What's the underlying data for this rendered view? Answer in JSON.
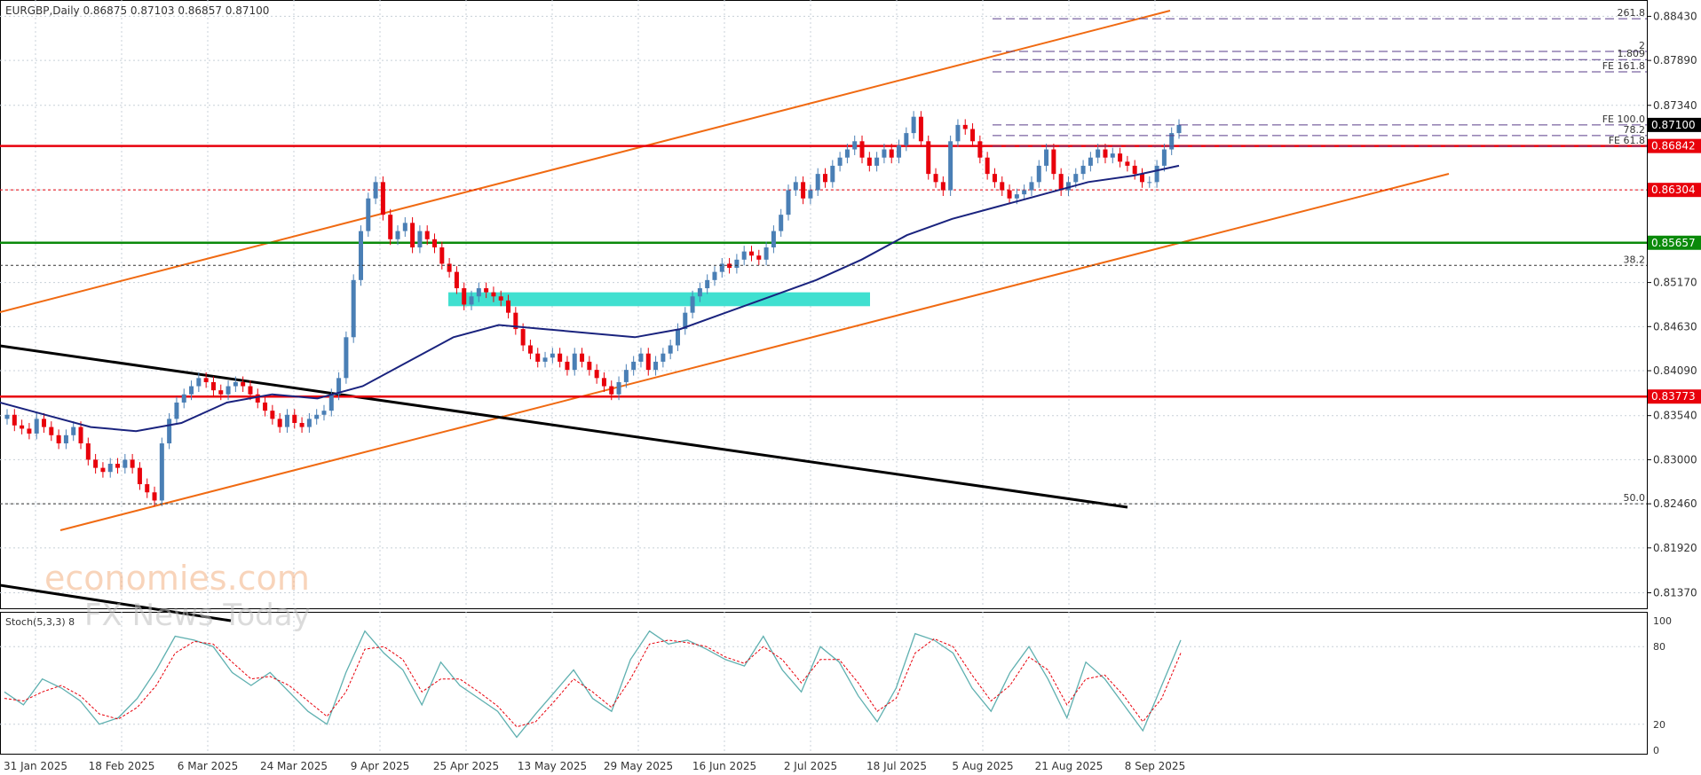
{
  "header": {
    "symbol_line": "EURGBP,Daily  0.86875 0.87103 0.86857 0.87100"
  },
  "stoch_label": "Stoch(5,3,3) 8",
  "watermark": {
    "line1": "economies.com",
    "line2": "FX News Today"
  },
  "colors": {
    "bull": "#4a7fb5",
    "bear": "#e8000b",
    "ma": "#1a237e",
    "channel": "#f06a12",
    "support_green": "#0a8a0a",
    "resistance_red": "#e8000b",
    "zone": "#40e0d0",
    "trend_black": "#000000",
    "fib_purple": "#5a3d8a",
    "stoch_main": "#5fb0b0",
    "stoch_signal": "#e8000b"
  },
  "chart_data": {
    "type": "candlestick",
    "symbol": "EURGBP",
    "timeframe": "Daily",
    "ohlc_last": {
      "open": 0.86875,
      "high": 0.87103,
      "low": 0.86857,
      "close": 0.871
    },
    "y_ticks": [
      "0.88430",
      "0.87890",
      "0.87340",
      "0.86842",
      "0.86304",
      "0.85657",
      "0.85170",
      "0.84630",
      "0.84090",
      "0.83773",
      "0.83540",
      "0.83000",
      "0.82460",
      "0.81920",
      "0.81370"
    ],
    "ylim": [
      0.8118,
      0.8863
    ],
    "x_ticks": [
      "31 Jan 2025",
      "18 Feb 2025",
      "6 Mar 2025",
      "24 Mar 2025",
      "9 Apr 2025",
      "25 Apr 2025",
      "13 May 2025",
      "29 May 2025",
      "16 Jun 2025",
      "2 Jul 2025",
      "18 Jul 2025",
      "5 Aug 2025",
      "21 Aug 2025",
      "8 Sep 2025"
    ],
    "closes": [
      0.8355,
      0.8342,
      0.8338,
      0.8332,
      0.835,
      0.834,
      0.833,
      0.832,
      0.833,
      0.834,
      0.832,
      0.83,
      0.829,
      0.8285,
      0.8295,
      0.829,
      0.83,
      0.829,
      0.827,
      0.826,
      0.825,
      0.832,
      0.835,
      0.837,
      0.838,
      0.839,
      0.84,
      0.8395,
      0.8385,
      0.838,
      0.839,
      0.8395,
      0.839,
      0.838,
      0.837,
      0.836,
      0.835,
      0.834,
      0.8355,
      0.8345,
      0.834,
      0.835,
      0.8355,
      0.836,
      0.838,
      0.84,
      0.845,
      0.852,
      0.858,
      0.862,
      0.864,
      0.86,
      0.857,
      0.858,
      0.859,
      0.856,
      0.858,
      0.857,
      0.856,
      0.854,
      0.853,
      0.851,
      0.849,
      0.85,
      0.851,
      0.8505,
      0.85,
      0.8495,
      0.848,
      0.846,
      0.844,
      0.843,
      0.842,
      0.8425,
      0.843,
      0.842,
      0.841,
      0.843,
      0.842,
      0.841,
      0.84,
      0.839,
      0.838,
      0.8395,
      0.841,
      0.842,
      0.843,
      0.841,
      0.842,
      0.843,
      0.844,
      0.846,
      0.848,
      0.85,
      0.851,
      0.852,
      0.853,
      0.854,
      0.8535,
      0.8545,
      0.8555,
      0.855,
      0.8545,
      0.856,
      0.858,
      0.86,
      0.863,
      0.864,
      0.862,
      0.863,
      0.865,
      0.864,
      0.866,
      0.867,
      0.868,
      0.869,
      0.867,
      0.866,
      0.867,
      0.868,
      0.867,
      0.8685,
      0.87,
      0.872,
      0.869,
      0.865,
      0.864,
      0.863,
      0.869,
      0.871,
      0.8705,
      0.869,
      0.867,
      0.865,
      0.864,
      0.863,
      0.862,
      0.8625,
      0.863,
      0.864,
      0.866,
      0.868,
      0.865,
      0.863,
      0.864,
      0.865,
      0.866,
      0.867,
      0.868,
      0.867,
      0.8675,
      0.8665,
      0.866,
      0.865,
      0.864,
      0.864,
      0.866,
      0.868,
      0.87,
      0.871
    ],
    "ma_values": [
      0.837,
      0.8355,
      0.834,
      0.8335,
      0.8345,
      0.837,
      0.838,
      0.8375,
      0.839,
      0.842,
      0.845,
      0.8465,
      0.846,
      0.8455,
      0.845,
      0.846,
      0.848,
      0.85,
      0.852,
      0.8545,
      0.8575,
      0.8595,
      0.861,
      0.8625,
      0.864,
      0.8648,
      0.866
    ],
    "horizontal_levels": [
      {
        "value": 0.86842,
        "label": "0.86842",
        "color": "#e8000b",
        "style": "solid"
      },
      {
        "value": 0.86304,
        "label": "0.86304",
        "color": "#e8000b",
        "style": "dotted"
      },
      {
        "value": 0.85657,
        "label": "0.85657",
        "color": "#0a8a0a",
        "style": "solid"
      },
      {
        "value": 0.83773,
        "label": "0.83773",
        "color": "#e8000b",
        "style": "solid"
      },
      {
        "value": 0.871,
        "label": "0.87100",
        "color": "#000000",
        "style": "price"
      }
    ],
    "fib_levels": [
      {
        "label": "261.8",
        "value": 0.884
      },
      {
        "label": "2",
        "value": 0.88
      },
      {
        "label": "1.809",
        "value": 0.879
      },
      {
        "label": "FE 161.8",
        "value": 0.8775
      },
      {
        "label": "FE 100.0",
        "value": 0.871
      },
      {
        "label": "78.2",
        "value": 0.8697
      },
      {
        "label": "FE 61.8",
        "value": 0.8684
      },
      {
        "label": "38.2",
        "value": 0.8538
      },
      {
        "label": "50.0",
        "value": 0.8246
      }
    ],
    "stochastic": {
      "name": "Stoch(5,3,3)",
      "levels": [
        0,
        20,
        80,
        100
      ],
      "main": [
        45,
        35,
        55,
        48,
        38,
        20,
        25,
        40,
        62,
        88,
        85,
        80,
        60,
        50,
        60,
        45,
        30,
        20,
        60,
        92,
        75,
        62,
        35,
        68,
        50,
        40,
        30,
        10,
        28,
        45,
        62,
        40,
        30,
        70,
        92,
        82,
        85,
        78,
        70,
        65,
        88,
        62,
        45,
        80,
        68,
        42,
        22,
        48,
        90,
        85,
        75,
        48,
        30,
        60,
        80,
        55,
        25,
        68,
        55,
        35,
        15,
        50,
        85
      ],
      "signal": [
        40,
        38,
        45,
        50,
        42,
        28,
        24,
        33,
        50,
        75,
        84,
        82,
        68,
        55,
        57,
        50,
        38,
        26,
        45,
        78,
        80,
        70,
        45,
        55,
        55,
        45,
        34,
        18,
        22,
        38,
        55,
        45,
        33,
        55,
        82,
        85,
        83,
        80,
        72,
        67,
        80,
        70,
        52,
        70,
        70,
        52,
        30,
        40,
        75,
        86,
        80,
        58,
        38,
        50,
        72,
        62,
        35,
        55,
        58,
        42,
        22,
        40,
        75
      ]
    }
  }
}
